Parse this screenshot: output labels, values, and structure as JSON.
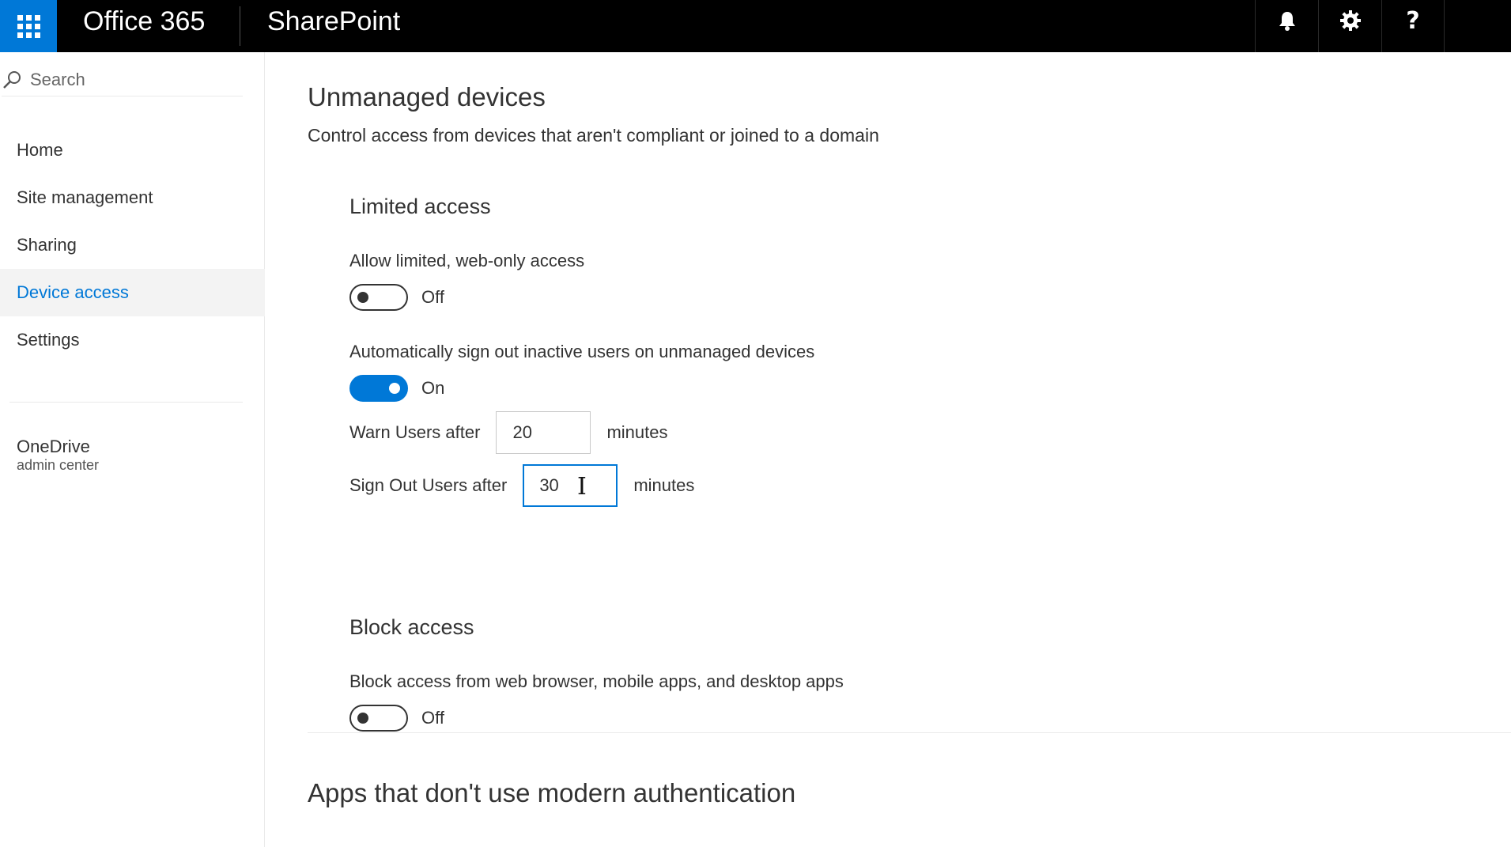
{
  "topbar": {
    "brand": "Office 365",
    "app_name": "SharePoint",
    "icons": [
      "app-launcher-icon",
      "bell-icon",
      "gear-icon",
      "help-icon"
    ]
  },
  "sidebar": {
    "search_placeholder": "Search",
    "items": [
      {
        "label": "Home",
        "active": false
      },
      {
        "label": "Site management",
        "active": false
      },
      {
        "label": "Sharing",
        "active": false
      },
      {
        "label": "Device access",
        "active": true
      },
      {
        "label": "Settings",
        "active": false
      }
    ],
    "onedrive": {
      "title": "OneDrive",
      "subtitle": "admin center"
    }
  },
  "main": {
    "title": "Unmanaged devices",
    "description": "Control access from devices that aren't compliant or joined to a domain",
    "limited_access": {
      "heading": "Limited access",
      "allow_label": "Allow limited, web-only access",
      "allow_state": "Off",
      "auto_signout_label": "Automatically sign out inactive users on unmanaged devices",
      "auto_signout_state": "On",
      "warn_label": "Warn Users after",
      "warn_value": "20",
      "warn_unit": "minutes",
      "signout_label": "Sign Out Users after",
      "signout_value": "30",
      "signout_unit": "minutes"
    },
    "block_access": {
      "heading": "Block access",
      "block_label": "Block access from web browser, mobile apps, and desktop apps",
      "block_state": "Off"
    },
    "apps_section": {
      "heading": "Apps that don't use modern authentication"
    }
  },
  "colors": {
    "accent": "#0078d7",
    "topbar": "#000000",
    "active_bg": "#f3f3f3"
  }
}
